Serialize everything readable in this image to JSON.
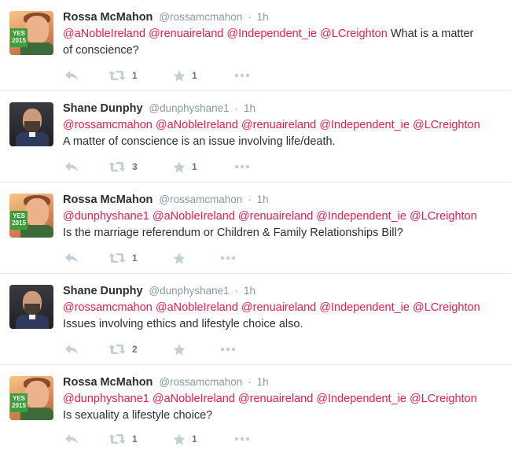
{
  "icons": {
    "reply": "reply-icon",
    "retweet": "retweet-icon",
    "favorite": "star-icon",
    "more": "more-icon"
  },
  "colors": {
    "mention": "#e81c4f",
    "muted": "#8899a6",
    "text": "#292f33",
    "divider": "#e1e8ed"
  },
  "tweets": [
    {
      "name": "Rossa McMahon",
      "handle": "@rossamcmahon",
      "separator": "·",
      "time": "1h",
      "mentions": "@aNobleIreland @renuaireland @Independent_ie @LCreighton",
      "text_inline": " What is a matter",
      "text_line2": "of conscience?",
      "retweets": "1",
      "favorites": "1",
      "avatar": "yes-badge",
      "avatar_badge": "YES\n2015"
    },
    {
      "name": "Shane Dunphy",
      "handle": "@dunphyshane1",
      "separator": "·",
      "time": "1h",
      "mentions": "@rossamcmahon @aNobleIreland @renuaireland @Independent_ie @LCreighton",
      "text_line2": "A matter of conscience is an issue involving life/death.",
      "retweets": "3",
      "favorites": "1",
      "avatar": "portrait"
    },
    {
      "name": "Rossa McMahon",
      "handle": "@rossamcmahon",
      "separator": "·",
      "time": "1h",
      "mentions": "@dunphyshane1 @aNobleIreland @renuaireland @Independent_ie @LCreighton",
      "text_line2": "Is the marriage referendum or Children & Family Relationships Bill?",
      "retweets": "1",
      "favorites": "",
      "avatar": "yes-badge",
      "avatar_badge": "YES\n2015"
    },
    {
      "name": "Shane Dunphy",
      "handle": "@dunphyshane1",
      "separator": "·",
      "time": "1h",
      "mentions": "@rossamcmahon @aNobleIreland @renuaireland @Independent_ie @LCreighton",
      "text_line2": "Issues involving ethics and lifestyle choice also.",
      "retweets": "2",
      "favorites": "",
      "avatar": "portrait"
    },
    {
      "name": "Rossa McMahon",
      "handle": "@rossamcmahon",
      "separator": "·",
      "time": "1h",
      "mentions": "@dunphyshane1 @aNobleIreland @renuaireland @Independent_ie @LCreighton",
      "text_line2": "Is sexuality a lifestyle choice?",
      "retweets": "1",
      "favorites": "1",
      "avatar": "yes-badge",
      "avatar_badge": "YES\n2015"
    }
  ]
}
